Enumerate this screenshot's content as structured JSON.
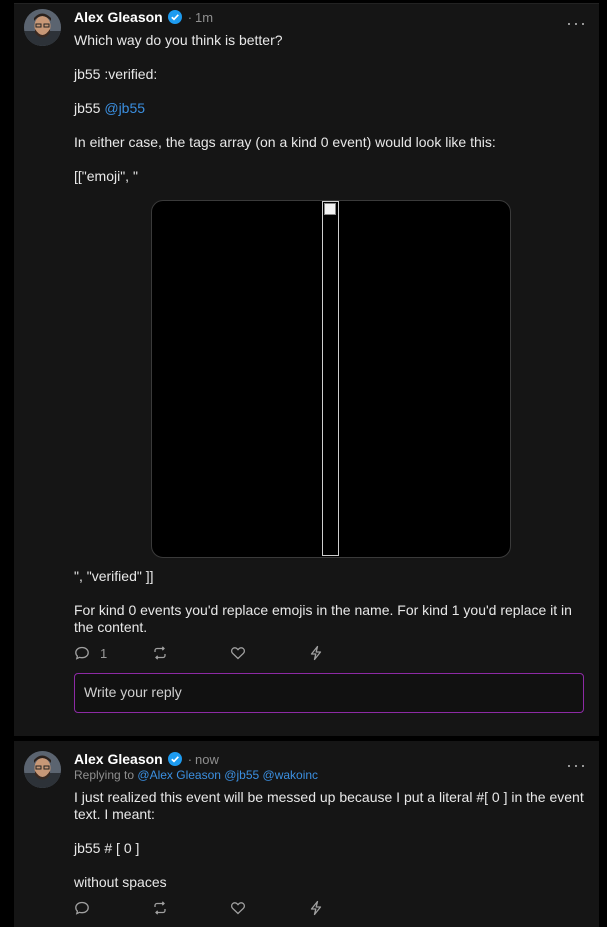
{
  "post1": {
    "author": "Alex Gleason",
    "separator": "·",
    "time": "1m",
    "more": "···",
    "line1": "Which way do you think is better?",
    "line2": "jb55 :verified:",
    "line3_prefix": "jb55 ",
    "line3_mention": "@jb55",
    "line4": "In either case, the tags array (on a kind 0 event) would look like this:",
    "line5": "[[\"emoji\", \"",
    "line6": "\", \"verified\" ]]",
    "line7": "For kind 0 events you'd replace emojis in the name. For kind 1 you'd replace it in the content.",
    "reply_count": "1",
    "reply_placeholder": "Write your reply"
  },
  "post2": {
    "author": "Alex Gleason",
    "separator": "·",
    "time": "now",
    "more": "···",
    "replying_label": "Replying to",
    "replying_mentions": [
      "@Alex Gleason",
      "@jb55",
      "@wakoinc"
    ],
    "line1": "I just realized this event will be messed up because I put a literal #[ 0 ] in the event text. I meant:",
    "line2": "jb55 # [ 0 ]",
    "line3": "without spaces"
  },
  "icons": {
    "reply": "comment-icon",
    "repost": "repost-icon",
    "like": "heart-icon",
    "zap": "lightning-icon",
    "verified": "verified-badge-icon"
  },
  "colors": {
    "background": "#000000",
    "card": "#151515",
    "mention": "#3b8fe0",
    "reply_border": "#8d2aa5",
    "verified": "#1d9bf0"
  }
}
